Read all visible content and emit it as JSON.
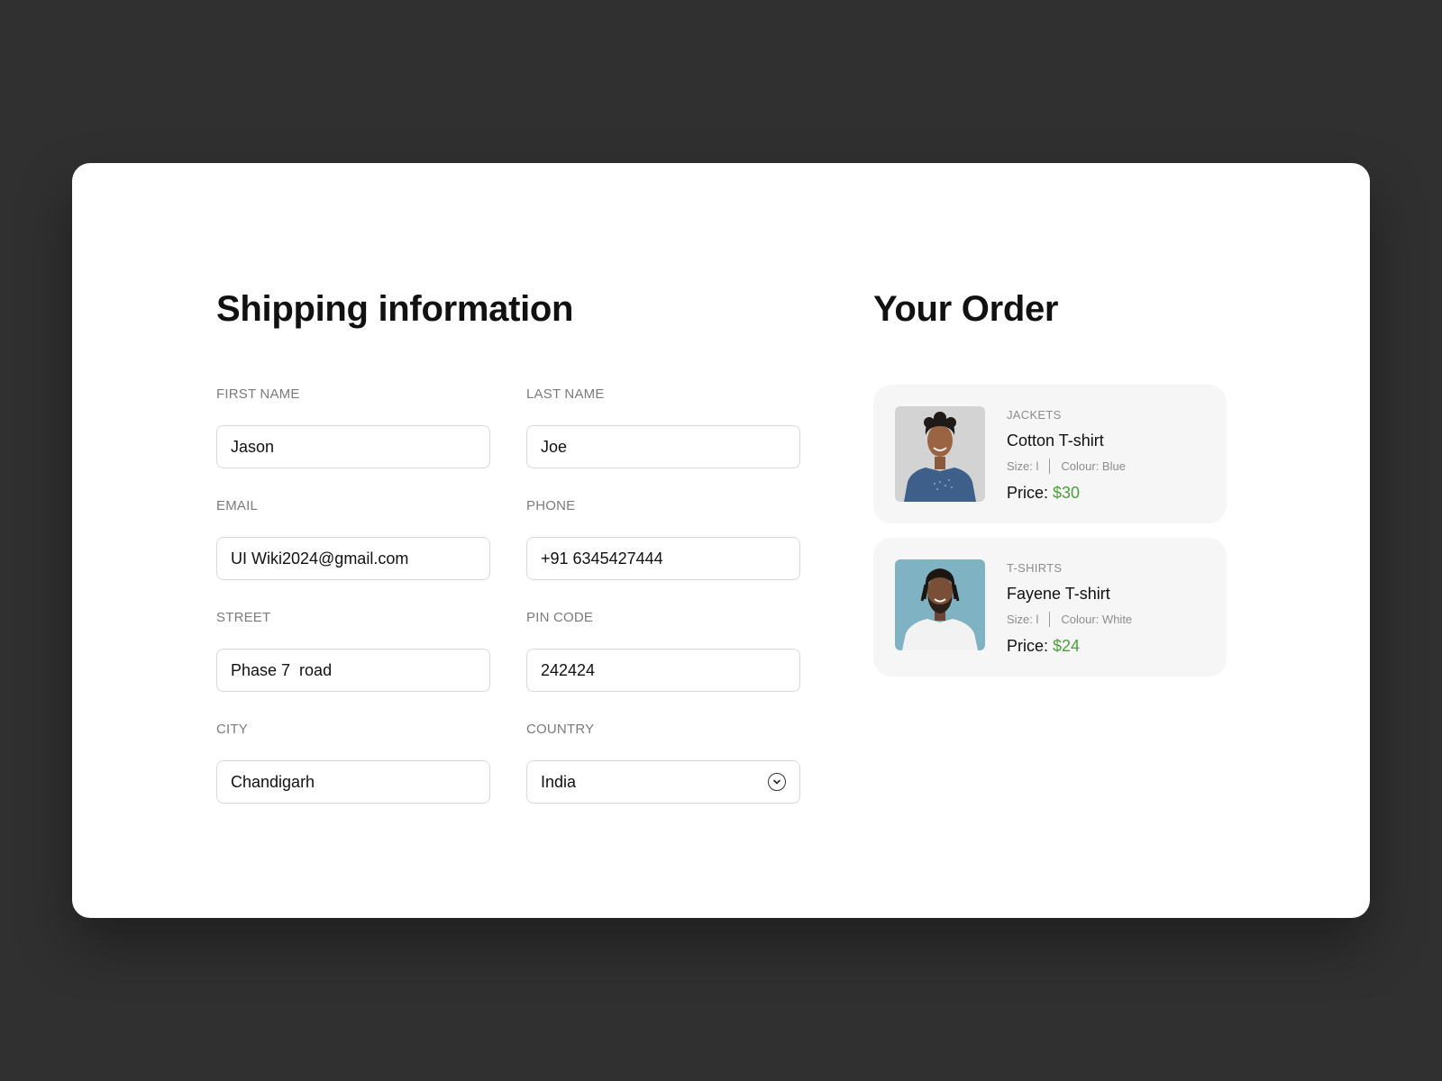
{
  "shipping": {
    "title": "Shipping information",
    "first_name": {
      "label": "FIRST NAME",
      "value": "Jason"
    },
    "last_name": {
      "label": "LAST NAME",
      "value": "Joe"
    },
    "email": {
      "label": "EMAIL",
      "value": "UI Wiki2024@gmail.com"
    },
    "phone": {
      "label": "PHONE",
      "value": "+91 6345427444"
    },
    "street": {
      "label": "STREET",
      "value": "Phase 7  road"
    },
    "pin_code": {
      "label": "PIN CODE",
      "value": "242424"
    },
    "city": {
      "label": "CITY",
      "value": "Chandigarh"
    },
    "country": {
      "label": "COUNTRY",
      "value": "India",
      "icon": "chevron-down-icon"
    }
  },
  "order": {
    "title": "Your Order",
    "items": [
      {
        "category": "JACKETS",
        "name": "Cotton T-shirt",
        "size": "Size: l",
        "colour": "Colour: Blue",
        "price_label": "Price:",
        "price": "$30"
      },
      {
        "category": "T-SHIRTS",
        "name": "Fayene T-shirt",
        "size": "Size: l",
        "colour": "Colour: White",
        "price_label": "Price:",
        "price": "$24"
      }
    ]
  },
  "colors": {
    "background": "#303030",
    "card": "#ffffff",
    "item_card": "#f6f6f6",
    "price_accent": "#4aa13a",
    "label": "#7b7b7b"
  }
}
